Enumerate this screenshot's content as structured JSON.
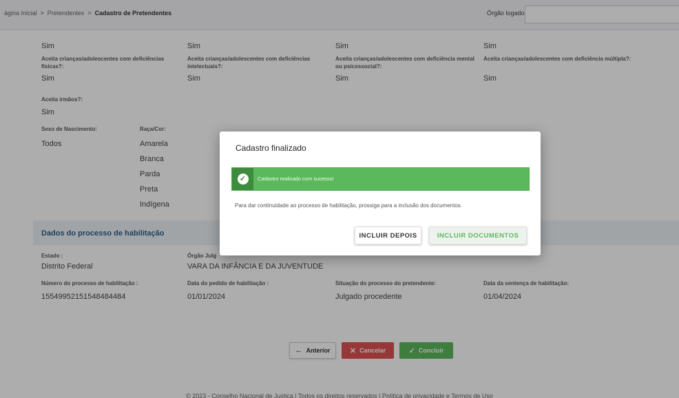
{
  "breadcrumb": {
    "home": "ágina Inicial",
    "separator": ">",
    "pretendentes": "Pretendentes",
    "current": "Cadastro de Pretendentes"
  },
  "header": {
    "orgao_label": "Órgão logado",
    "orgao_value": ""
  },
  "deficiencia": {
    "row0_values": [
      "Sim",
      "Sim",
      "Sim",
      "Sim"
    ],
    "labels": [
      "Aceita crianças/adolescentes com deficiências físicas?:",
      "Aceita crianças/adolescentes com deficiências intelectuais?:",
      "Aceita crianças/adolescentes com deficiência mental ou psicossocial?:",
      "Aceita crianças/adolescentes com deficiência múltipla?:"
    ],
    "values": [
      "Sim",
      "Sim",
      "Sim",
      "Sim"
    ]
  },
  "irmaos": {
    "label": "Aceita irmãos?:",
    "value": "Sim"
  },
  "sexo": {
    "label": "Sexo de Nascimento:",
    "value": "Todos"
  },
  "raca": {
    "label": "Raça/Cor:",
    "values": [
      "Amarela",
      "Branca",
      "Parda",
      "Preta",
      "Indígena"
    ]
  },
  "habilitacao": {
    "title": "Dados do processo de habilitação",
    "estado_label": "Estado :",
    "estado_value": "Distrito Federal",
    "orgao_label": "Órgão Julg",
    "orgao_value": "VARA DA INFÂNCIA E DA JUVENTUDE",
    "numero_label": "Número do processo de habilitação :",
    "numero_value": "15549952151548484484",
    "data_pedido_label": "Data do pedido de habilitação :",
    "data_pedido_value": "01/01/2024",
    "situacao_label": "Situação do processo do pretendente:",
    "situacao_value": "Julgado procedente",
    "data_sentenca_label": "Data da sentença de habilitação:",
    "data_sentenca_value": "01/04/2024"
  },
  "actions": {
    "anterior": "Anterior",
    "cancelar": "Cancelar",
    "concluir": "Concluir"
  },
  "footer": "© 2023 - Conselho Nacional de Justiça | Todos os direitos reservados | Política de privacidade e Termos de Uso",
  "modal": {
    "title": "Cadastro finalizado",
    "alert": "Cadastro realizado com sucesso!",
    "message": "Para dar continuidade ao processo de habilitação, prossiga para a inclusão dos documentos.",
    "btn_depois": "INCLUIR DEPOIS",
    "btn_docs": "INCLUIR DOCUMENTOS"
  },
  "colors": {
    "success": "#5cb85c",
    "success_dark": "#3d8b3d",
    "danger": "#e05252",
    "section_title": "#2f5d8a"
  },
  "icons": {
    "alert": "check-circle-icon",
    "anterior": "arrow-left-icon",
    "cancelar": "x-icon",
    "concluir": "check-icon"
  }
}
